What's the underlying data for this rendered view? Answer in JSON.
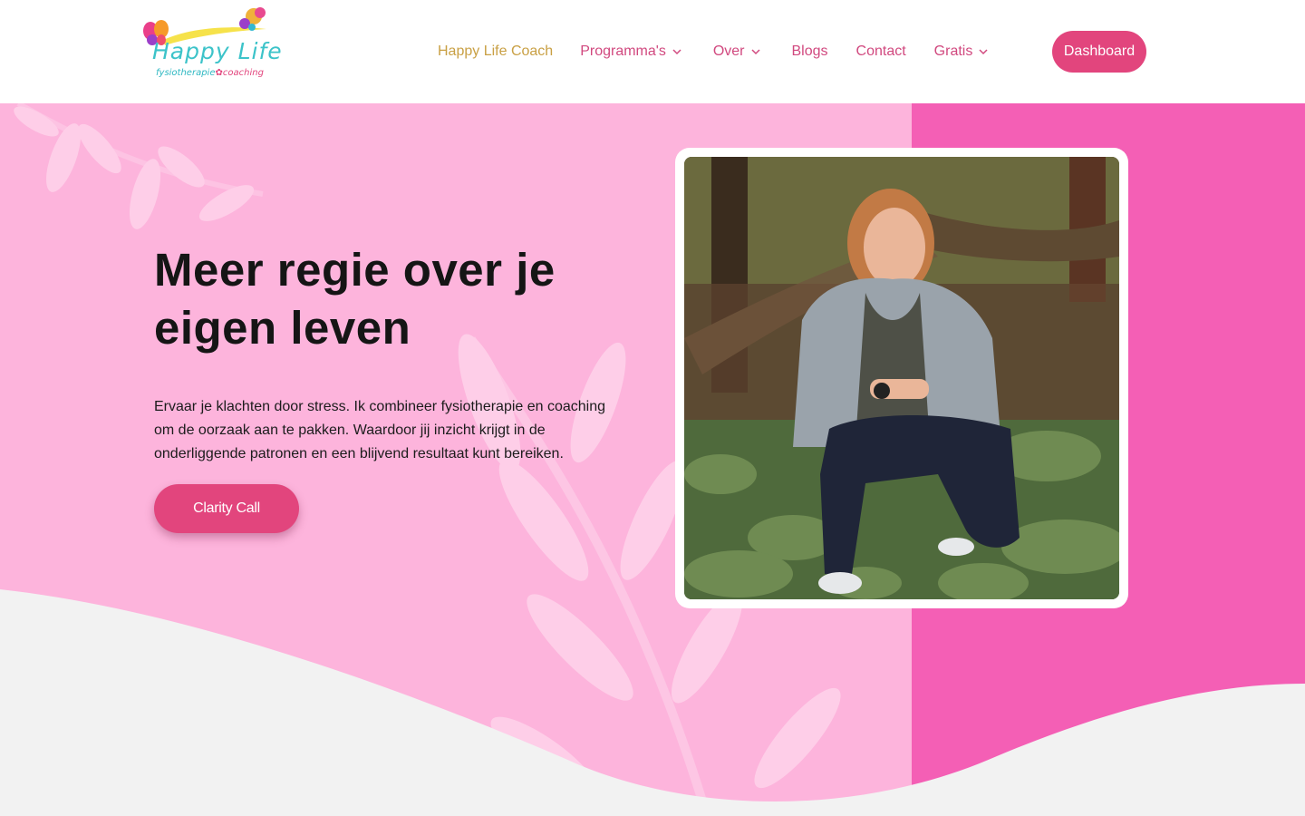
{
  "header": {
    "logo_title": "Happy Life",
    "logo_sub_a": "fysiotherapie",
    "logo_sub_b": "coaching",
    "nav": [
      {
        "label": "Happy Life Coach",
        "dropdown": false,
        "active": true
      },
      {
        "label": "Programma's",
        "dropdown": true,
        "active": false
      },
      {
        "label": "Over",
        "dropdown": true,
        "active": false
      },
      {
        "label": "Blogs",
        "dropdown": false,
        "active": false
      },
      {
        "label": "Contact",
        "dropdown": false,
        "active": false
      },
      {
        "label": "Gratis",
        "dropdown": true,
        "active": false
      }
    ],
    "dashboard_label": "Dashboard"
  },
  "hero": {
    "title_line1": "Meer regie over je",
    "title_line2": "eigen leven",
    "text": "Ervaar je klachten door stress. Ik combineer fysiotherapie en coaching om de oorzaak aan te pakken. Waardoor jij inzicht krijgt in de onderliggende patronen en een blijvend resultaat kunt bereiken.",
    "cta_label": "Clarity Call",
    "photo_icon": "portrait-photo"
  },
  "colors": {
    "accent": "#e2457d",
    "nav_active": "#c9a044",
    "hero_pink_light": "#fdb4dc",
    "hero_pink_dark": "#f45fb5",
    "page_bg": "#f2f2f2"
  }
}
